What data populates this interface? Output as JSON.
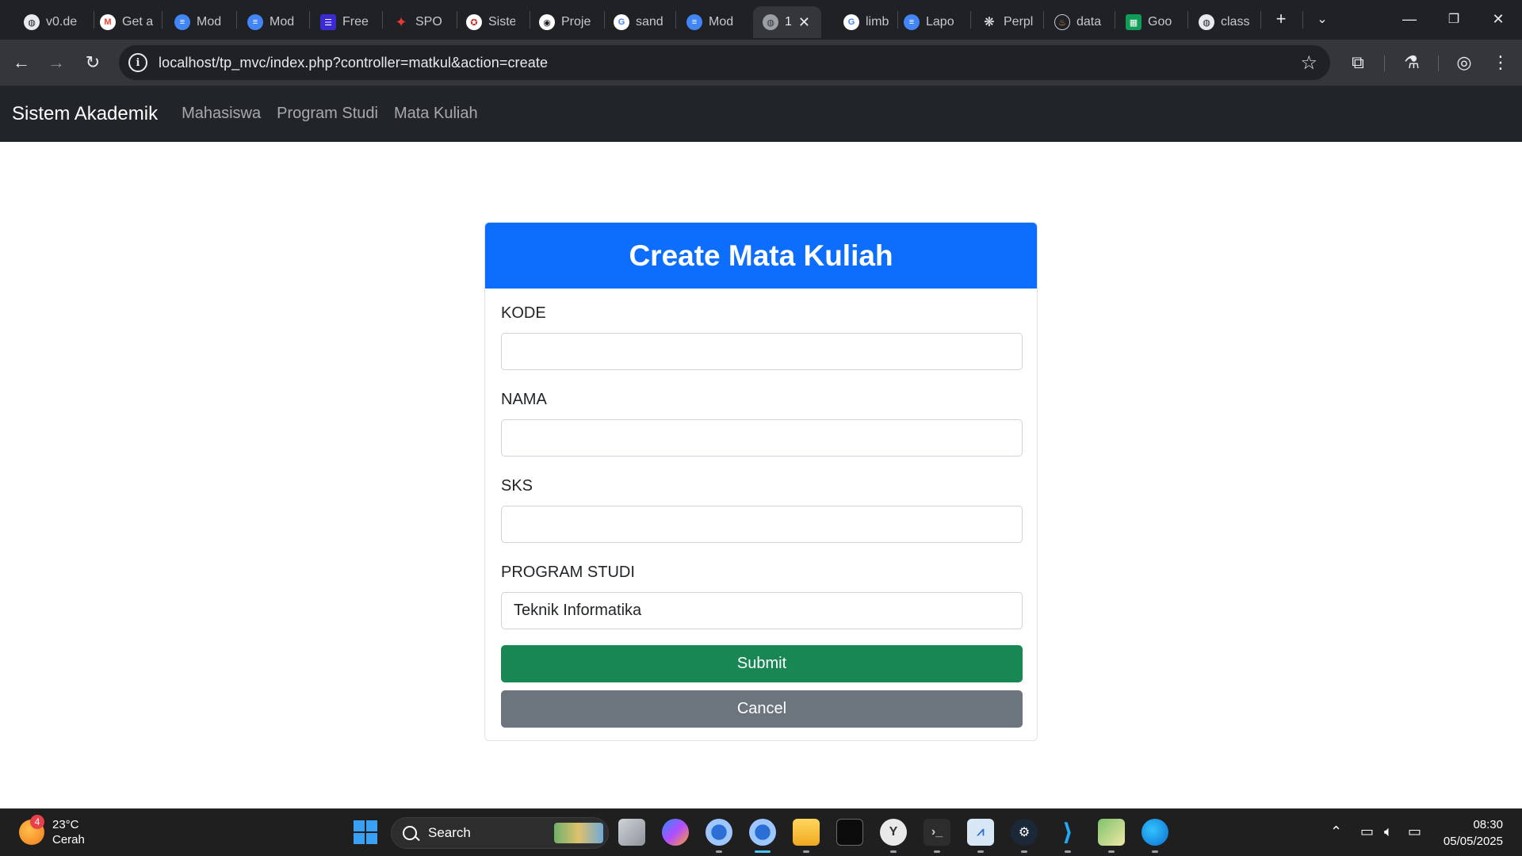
{
  "browser": {
    "tabs": [
      {
        "label": "v0.de",
        "icon": "globe-icon"
      },
      {
        "label": "Get a",
        "icon": "gmail-icon"
      },
      {
        "label": "Mod",
        "icon": "docs-icon"
      },
      {
        "label": "Mod",
        "icon": "docs-icon"
      },
      {
        "label": "Free",
        "icon": "menu-lines-icon"
      },
      {
        "label": "SPOT",
        "icon": "spot-icon"
      },
      {
        "label": "Siste",
        "icon": "siste-icon"
      },
      {
        "label": "Proje",
        "icon": "proje-icon"
      },
      {
        "label": "sand",
        "icon": "google-icon"
      },
      {
        "label": "Mod",
        "icon": "docs-icon"
      },
      {
        "label": "1",
        "icon": "globe-icon",
        "active": true
      },
      {
        "label": "limb",
        "icon": "google-icon"
      },
      {
        "label": "Lapo",
        "icon": "docs-icon"
      },
      {
        "label": "Perpl",
        "icon": "perplexity-icon"
      },
      {
        "label": "data",
        "icon": "data-icon"
      },
      {
        "label": "Goo",
        "icon": "sheets-icon"
      },
      {
        "label": "class",
        "icon": "globe-icon"
      }
    ],
    "url": "localhost/tp_mvc/index.php?controller=matkul&action=create"
  },
  "navbar": {
    "brand": "Sistem Akademik",
    "links": [
      "Mahasiswa",
      "Program Studi",
      "Mata Kuliah"
    ]
  },
  "form": {
    "title": "Create Mata Kuliah",
    "fields": [
      {
        "label": "KODE",
        "value": ""
      },
      {
        "label": "NAMA",
        "value": ""
      },
      {
        "label": "SKS",
        "value": ""
      },
      {
        "label": "PROGRAM STUDI",
        "value": "Teknik Informatika"
      }
    ],
    "submit_label": "Submit",
    "cancel_label": "Cancel"
  },
  "taskbar": {
    "weather_temp": "23°C",
    "weather_desc": "Cerah",
    "weather_badge": "4",
    "search_label": "Search",
    "time": "08:30",
    "date": "05/05/2025"
  },
  "colors": {
    "navbar_bg": "#212529",
    "header_bg": "#0d6efd",
    "submit_bg": "#198754",
    "cancel_bg": "#6c757d"
  }
}
